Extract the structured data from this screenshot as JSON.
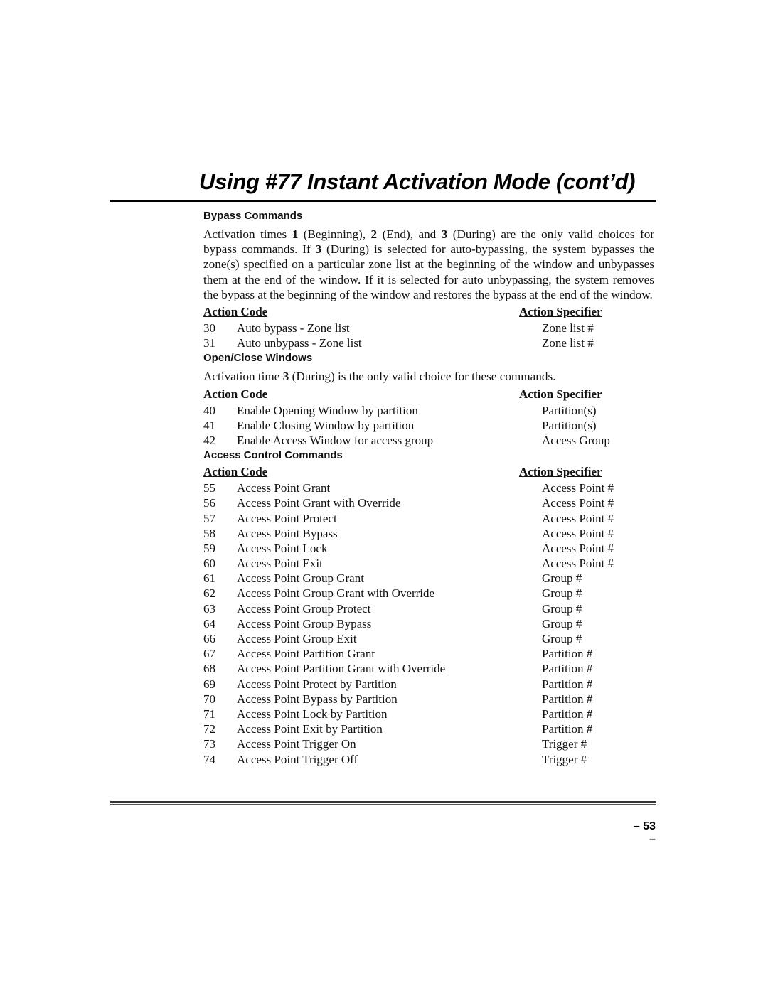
{
  "page": {
    "title": "Using #77 Instant Activation Mode (cont’d)",
    "page_number": "– 53 –"
  },
  "bypass": {
    "heading": "Bypass Commands",
    "paragraph": [
      {
        "t": "Activation times "
      },
      {
        "b": "1"
      },
      {
        "t": " (Beginning), "
      },
      {
        "b": "2"
      },
      {
        "t": " (End), and "
      },
      {
        "b": "3"
      },
      {
        "t": " (During) are the only valid choices for bypass commands.  If "
      },
      {
        "b": "3"
      },
      {
        "t": " (During) is selected for auto-bypassing, the system bypasses the zone(s) specified on a particular zone list at the beginning of the window and unbypasses them at the end of the window.  If it is selected for auto unbypassing, the system removes the bypass at the beginning of the window and restores the bypass at the end of the window."
      }
    ],
    "col_code": "Action Code",
    "col_spec": "Action Specifier",
    "rows": [
      {
        "code": "30",
        "desc": "Auto bypass - Zone list",
        "spec": "Zone list #"
      },
      {
        "code": "31",
        "desc": "Auto unbypass - Zone list",
        "spec": "Zone list #"
      }
    ]
  },
  "openclose": {
    "heading": "Open/Close Windows",
    "paragraph": [
      {
        "t": "Activation time "
      },
      {
        "b": "3"
      },
      {
        "t": " (During) is the only valid choice for these commands."
      }
    ],
    "col_code": "Action Code",
    "col_spec": "Action Specifier",
    "rows": [
      {
        "code": "40",
        "desc": "Enable Opening Window by partition",
        "spec": "Partition(s)"
      },
      {
        "code": "41",
        "desc": "Enable Closing Window by partition",
        "spec": "Partition(s)"
      },
      {
        "code": "42",
        "desc": "Enable Access Window for access group",
        "spec": "Access Group"
      }
    ]
  },
  "access": {
    "heading": "Access Control Commands",
    "col_code": "Action Code",
    "col_spec": "Action Specifier",
    "rows": [
      {
        "code": "55",
        "desc": "Access Point Grant",
        "spec": "Access Point #"
      },
      {
        "code": "56",
        "desc": "Access Point Grant with Override",
        "spec": "Access Point #"
      },
      {
        "code": "57",
        "desc": "Access Point Protect",
        "spec": "Access Point #"
      },
      {
        "code": "58",
        "desc": "Access Point Bypass",
        "spec": "Access Point #"
      },
      {
        "code": "59",
        "desc": "Access Point Lock",
        "spec": "Access Point #"
      },
      {
        "code": "60",
        "desc": "Access Point Exit",
        "spec": "Access Point #"
      },
      {
        "code": "61",
        "desc": "Access Point Group Grant",
        "spec": "Group #"
      },
      {
        "code": "62",
        "desc": "Access Point Group Grant with Override",
        "spec": "Group #"
      },
      {
        "code": "63",
        "desc": "Access Point Group Protect",
        "spec": "Group #"
      },
      {
        "code": "64",
        "desc": "Access Point Group Bypass",
        "spec": "Group #"
      },
      {
        "code": "66",
        "desc": "Access Point Group Exit",
        "spec": "Group #"
      },
      {
        "code": "67",
        "desc": "Access Point Partition Grant",
        "spec": "Partition #"
      },
      {
        "code": "68",
        "desc": "Access Point Partition Grant with Override",
        "spec": "Partition #"
      },
      {
        "code": "69",
        "desc": "Access Point Protect by Partition",
        "spec": "Partition #"
      },
      {
        "code": "70",
        "desc": "Access Point Bypass by Partition",
        "spec": "Partition #"
      },
      {
        "code": "71",
        "desc": "Access Point Lock by Partition",
        "spec": "Partition #"
      },
      {
        "code": "72",
        "desc": "Access Point Exit by Partition",
        "spec": "Partition #"
      },
      {
        "code": "73",
        "desc": "Access Point Trigger On",
        "spec": "Trigger #"
      },
      {
        "code": "74",
        "desc": "Access Point Trigger Off",
        "spec": "Trigger #"
      }
    ]
  }
}
